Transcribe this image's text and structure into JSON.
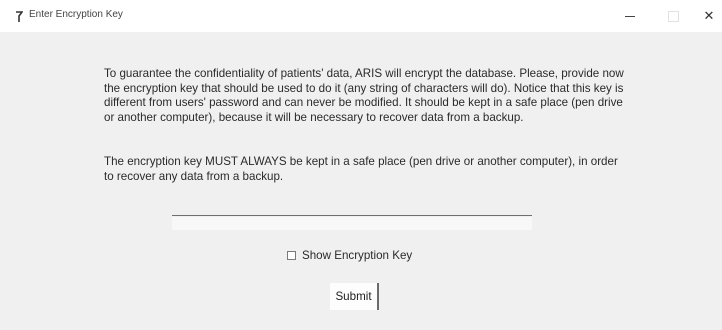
{
  "window": {
    "title": "Enter Encryption Key",
    "minimize_icon": "minimize-icon",
    "maximize_icon": "maximize-icon",
    "close_icon": "close-icon",
    "close_glyph": "✕"
  },
  "main": {
    "paragraph_1": "To guarantee the confidentiality of patients' data, ARIS will encrypt the database. Please, provide now the encryption key that should be used to do it (any string of characters will do). Notice that this key is different from users' password and can never be modified. It should be kept in a safe place (pen drive or another computer), because it will be necessary to recover data from a backup.",
    "paragraph_2": "The encryption key MUST ALWAYS be kept in a safe place (pen drive or another computer), in order to recover any data from a backup.",
    "key_input_value": "",
    "show_key_label": "Show Encryption Key",
    "show_key_checked": false,
    "submit_label": "Submit"
  }
}
